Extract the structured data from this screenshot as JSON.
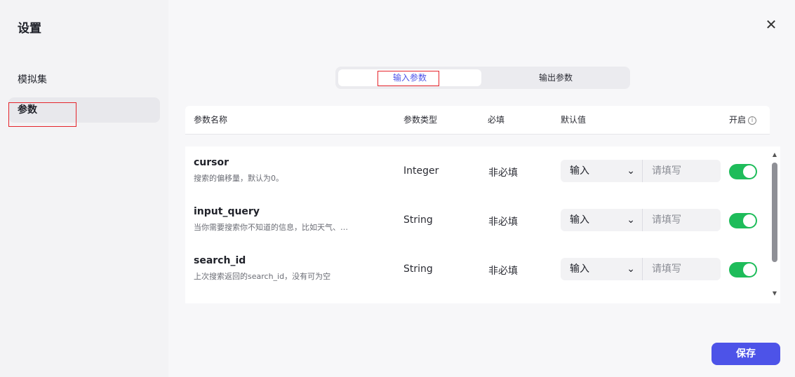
{
  "sidebar": {
    "title": "设置",
    "items": [
      {
        "label": "模拟集"
      },
      {
        "label": "参数"
      }
    ]
  },
  "tabs": [
    {
      "label": "输入参数",
      "active": true
    },
    {
      "label": "输出参数",
      "active": false
    }
  ],
  "table": {
    "columns": {
      "name": "参数名称",
      "type": "参数类型",
      "required": "必填",
      "default": "默认值",
      "enabled": "开启"
    },
    "rows": [
      {
        "name": "cursor",
        "desc": "搜索的偏移量，默认为0。",
        "type": "Integer",
        "required": "非必填",
        "default_mode": "输入",
        "default_placeholder": "请填写",
        "enabled": true
      },
      {
        "name": "input_query",
        "desc": "当你需要搜索你不知道的信息，比如天气、…",
        "type": "String",
        "required": "非必填",
        "default_mode": "输入",
        "default_placeholder": "请填写",
        "enabled": true
      },
      {
        "name": "search_id",
        "desc": "上次搜索返回的search_id，没有可为空",
        "type": "String",
        "required": "非必填",
        "default_mode": "输入",
        "default_placeholder": "请填写",
        "enabled": true
      }
    ]
  },
  "footer": {
    "save_label": "保存"
  },
  "colors": {
    "accent": "#4d53e8",
    "toggle_on": "#1ebc5a",
    "highlight_box": "#e5242b"
  }
}
